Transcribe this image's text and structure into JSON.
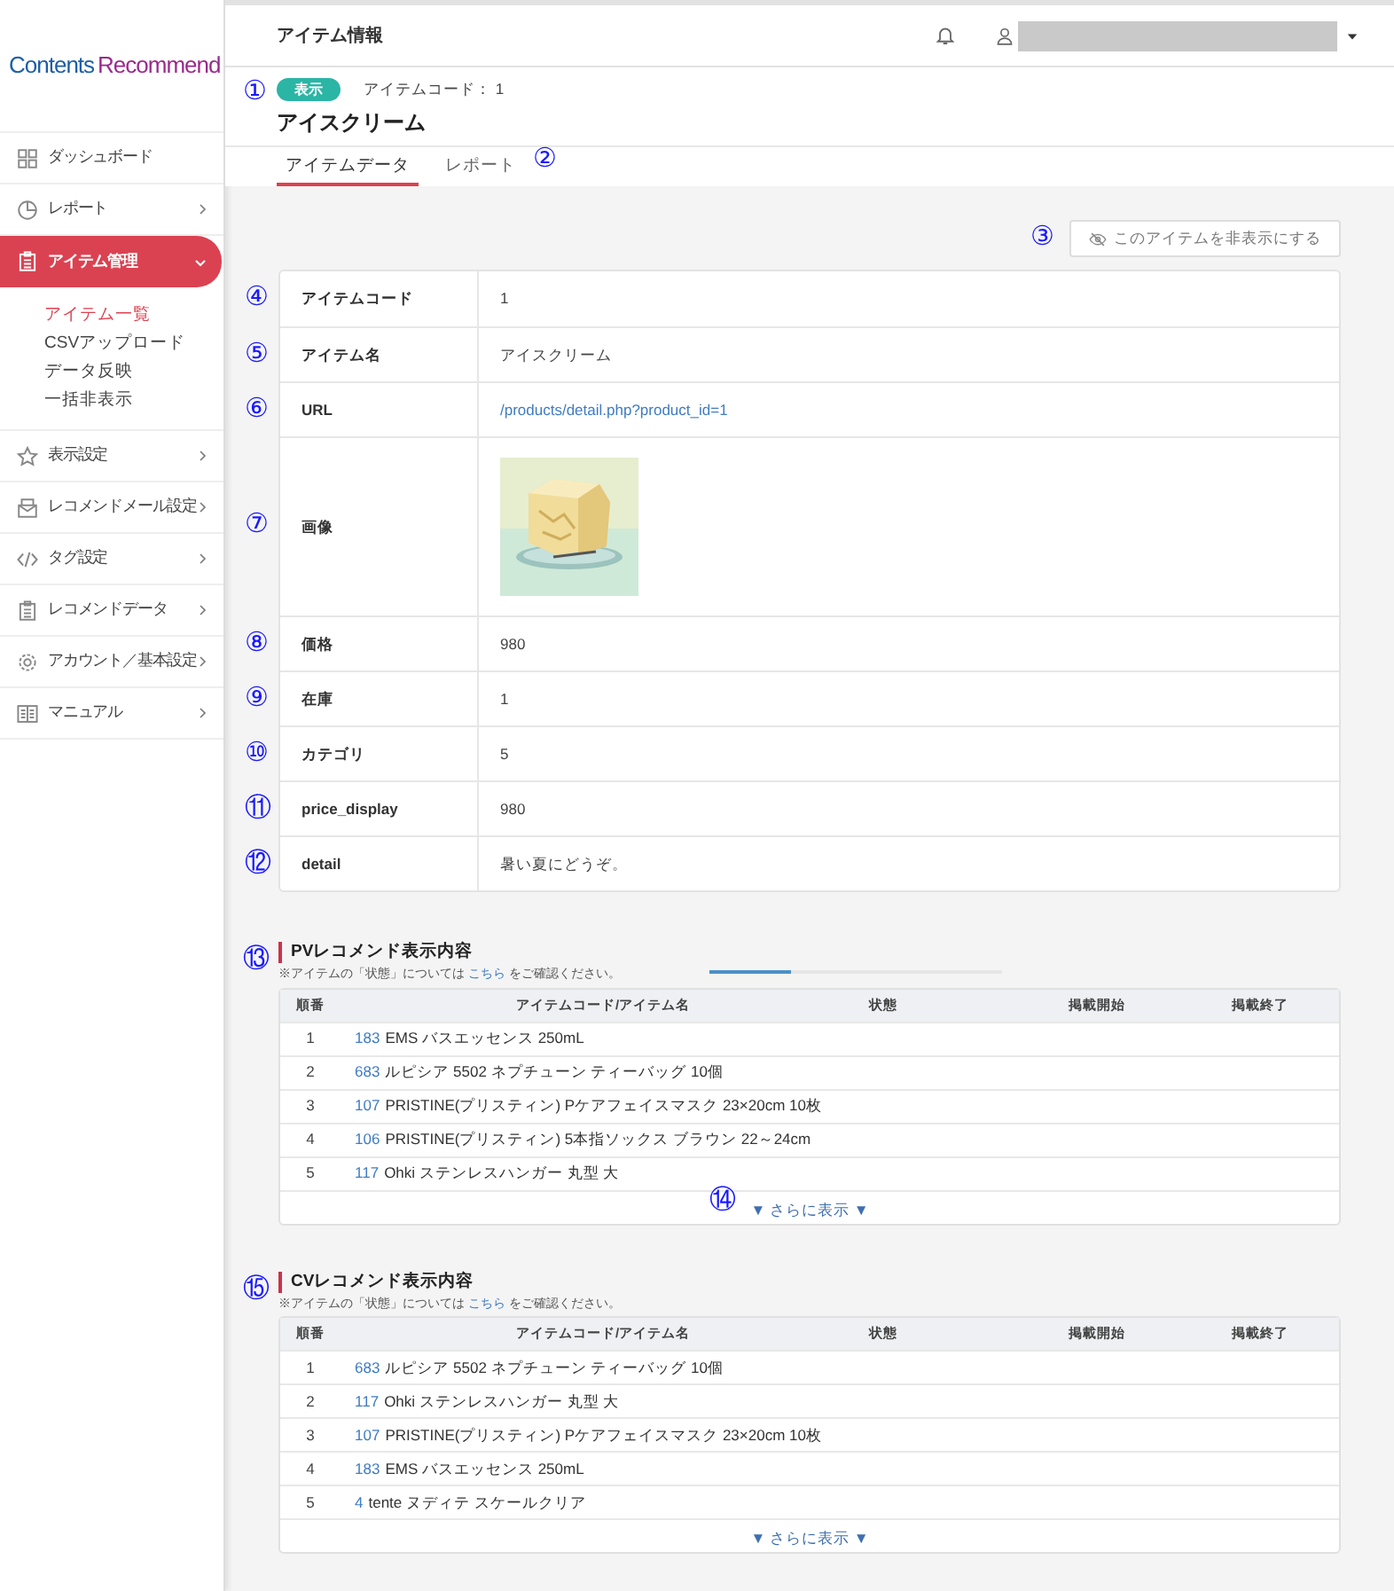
{
  "sidebar": {
    "logo": {
      "part_1": "Contents",
      "part_2": "Recommend"
    },
    "nav": [
      {
        "label": "ダッシュボード",
        "selected": false
      },
      {
        "label": "レポート",
        "selected": false,
        "expanded": false
      },
      {
        "label": "アイテム管理",
        "selected": true,
        "expanded": true,
        "children": [
          {
            "label": "アイテム一覧",
            "selected": true
          },
          {
            "label": "CSVアップロード",
            "selected": false
          },
          {
            "label": "データ反映",
            "selected": false
          },
          {
            "label": "一括非表示",
            "selected": false
          }
        ]
      },
      {
        "label": "表示設定",
        "selected": false,
        "expanded": false
      },
      {
        "label": "レコメンドメール設定",
        "selected": false,
        "expanded": false
      },
      {
        "label": "タグ設定",
        "selected": false,
        "expanded": false
      },
      {
        "label": "レコメンドデータ",
        "selected": false,
        "expanded": false
      },
      {
        "label": "アカウント／基本設定",
        "selected": false,
        "expanded": false
      },
      {
        "label": "マニュアル",
        "selected": false,
        "expanded": false
      }
    ]
  },
  "header": {
    "title": "アイテム情報"
  },
  "item": {
    "annotation": "①",
    "status_badge": "表示",
    "code_label": "アイテムコード：",
    "code": "1",
    "name": "アイスクリーム"
  },
  "tabs": [
    {
      "label": "アイテムデータ",
      "selected": true
    },
    {
      "label": "レポート",
      "selected": false,
      "annotation": "②"
    }
  ],
  "hide_button": {
    "label": "このアイテムを非表示にする",
    "annotation": "③"
  },
  "details": [
    {
      "annotation": "④",
      "label": "アイテムコード",
      "kind": "text",
      "value": "1"
    },
    {
      "annotation": "⑤",
      "label": "アイテム名",
      "kind": "text",
      "value": "アイスクリーム"
    },
    {
      "annotation": "⑥",
      "label": "URL",
      "kind": "link",
      "value": "/products/detail.php?product_id=1"
    },
    {
      "annotation": "⑦",
      "label": "画像",
      "kind": "picture"
    },
    {
      "annotation": "⑧",
      "label": "価格",
      "kind": "text",
      "value": "980"
    },
    {
      "annotation": "⑨",
      "label": "在庫",
      "kind": "text",
      "value": "1"
    },
    {
      "annotation": "⑩",
      "label": "カテゴリ",
      "kind": "text",
      "value": "5"
    },
    {
      "annotation": "⑪",
      "label": "price_display",
      "kind": "text",
      "value": "980"
    },
    {
      "annotation": "⑫",
      "label": "detail",
      "kind": "text",
      "value": "暑い夏にどうぞ。"
    }
  ],
  "sections": [
    {
      "annotation": "⑬",
      "title": "PVレコメンド表示内容",
      "note_before": "※アイテムの「状態」については ",
      "note_link": "こちら",
      "note_after": " をご確認ください。",
      "progress": {
        "level": 0.28
      },
      "columns": [
        "順番",
        "アイテムコード/アイテム名",
        "状態",
        "掲載開始",
        "掲載終了"
      ],
      "rows": [
        {
          "rank": "1",
          "code": "183",
          "name": "EMS バスエッセンス 250mL"
        },
        {
          "rank": "2",
          "code": "683",
          "name": "ルピシア 5502 ネプチューン ティーバッグ 10個"
        },
        {
          "rank": "3",
          "code": "107",
          "name": "PRISTINE(プリスティン) Pケアフェイスマスク 23×20cm 10枚"
        },
        {
          "rank": "4",
          "code": "106",
          "name": "PRISTINE(プリスティン) 5本指ソックス ブラウン 22～24cm"
        },
        {
          "rank": "5",
          "code": "117",
          "name": "Ohki ステンレスハンガー 丸型 大"
        }
      ],
      "more": {
        "label": "▼ さらに表示 ▼",
        "annotation": "⑭"
      }
    },
    {
      "annotation": "⑮",
      "title": "CVレコメンド表示内容",
      "note_before": "※アイテムの「状態」については ",
      "note_link": "こちら",
      "note_after": " をご確認ください。",
      "columns": [
        "順番",
        "アイテムコード/アイテム名",
        "状態",
        "掲載開始",
        "掲載終了"
      ],
      "rows": [
        {
          "rank": "1",
          "code": "683",
          "name": "ルピシア 5502 ネプチューン ティーバッグ 10個"
        },
        {
          "rank": "2",
          "code": "117",
          "name": "Ohki ステンレスハンガー 丸型 大"
        },
        {
          "rank": "3",
          "code": "107",
          "name": "PRISTINE(プリスティン) Pケアフェイスマスク 23×20cm 10枚"
        },
        {
          "rank": "4",
          "code": "183",
          "name": "EMS バスエッセンス 250mL"
        },
        {
          "rank": "5",
          "code": "4",
          "name": "tente ヌディテ スケールクリア"
        }
      ],
      "more": {
        "label": "▼ さらに表示 ▼"
      }
    }
  ]
}
